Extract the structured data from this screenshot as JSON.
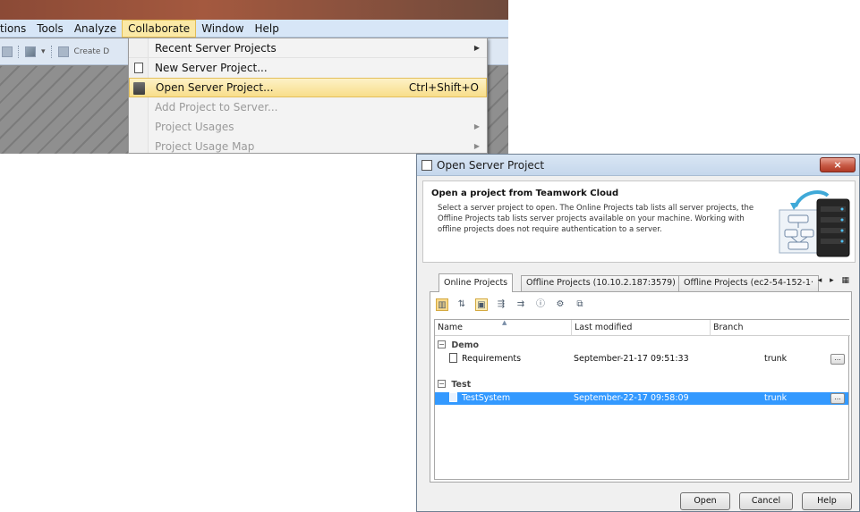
{
  "menubar": {
    "items": [
      "tions",
      "Tools",
      "Analyze",
      "Collaborate",
      "Window",
      "Help"
    ],
    "active_index": 3
  },
  "toolbar": {
    "create_label": "Create D"
  },
  "collaborate_menu": {
    "items": [
      {
        "label": "Recent Server Projects",
        "submenu": true,
        "disabled": false
      },
      {
        "label": "New Server Project...",
        "submenu": false,
        "disabled": false,
        "icon": "document-icon"
      },
      {
        "label": "Open Server Project...",
        "shortcut": "Ctrl+Shift+O",
        "highlighted": true,
        "icon": "open-server-project-icon"
      },
      {
        "label": "Add Project to Server...",
        "disabled": true
      },
      {
        "label": "Project Usages",
        "submenu": true,
        "disabled": true
      },
      {
        "label": "Project Usage Map",
        "submenu": true,
        "disabled": true
      }
    ]
  },
  "dialog": {
    "title": "Open Server Project",
    "close_glyph": "×",
    "header": {
      "heading": "Open a project from Teamwork Cloud",
      "description": "Select a server project to open. The Online Projects tab lists all server projects, the Offline Projects tab lists server projects available on your machine. Working with offline projects does not require authentication to a server."
    },
    "tabs": [
      {
        "label": "Online Projects",
        "selected": true
      },
      {
        "label": "Offline Projects (10.10.2.187:3579)",
        "selected": false
      },
      {
        "label": "Offline Projects (ec2-54-152-1·",
        "selected": false
      }
    ],
    "tab_nav": "◂ ▸ ▦",
    "table": {
      "columns": [
        "Name",
        "Last modified",
        "Branch"
      ],
      "groups": [
        {
          "name": "Demo",
          "rows": [
            {
              "name": "Requirements",
              "last_modified": "September-21-17 09:51:33",
              "branch": "trunk",
              "selected": false
            }
          ]
        },
        {
          "name": "Test",
          "rows": [
            {
              "name": "TestSystem",
              "last_modified": "September-22-17 09:58:09",
              "branch": "trunk",
              "selected": true
            }
          ]
        }
      ],
      "more_glyph": "..."
    },
    "buttons": {
      "open": "Open",
      "cancel": "Cancel",
      "help": "Help"
    },
    "colors": {
      "selection": "#3399ff",
      "menu_highlight": "#f8de8a"
    }
  }
}
